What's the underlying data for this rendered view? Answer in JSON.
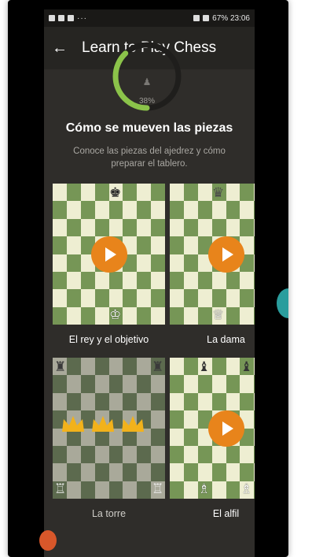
{
  "status_bar": {
    "right_text": "67% 23:06"
  },
  "app_bar": {
    "title": "Learn to Play Chess"
  },
  "progress": {
    "percent_label": "38%",
    "value": 0.38
  },
  "section": {
    "title": "Cómo se mueven las piezas",
    "subtitle": "Conoce las piezas del ajedrez y cómo preparar el tablero."
  },
  "lessons": [
    {
      "label": "El rey y el objetivo"
    },
    {
      "label": "La dama"
    },
    {
      "label": "La torre"
    },
    {
      "label": "El alfil"
    }
  ],
  "colors": {
    "board_light": "#eeeed2",
    "board_dark": "#769656",
    "play_button": "#e8841b",
    "progress_arc": "#8bc34a"
  }
}
